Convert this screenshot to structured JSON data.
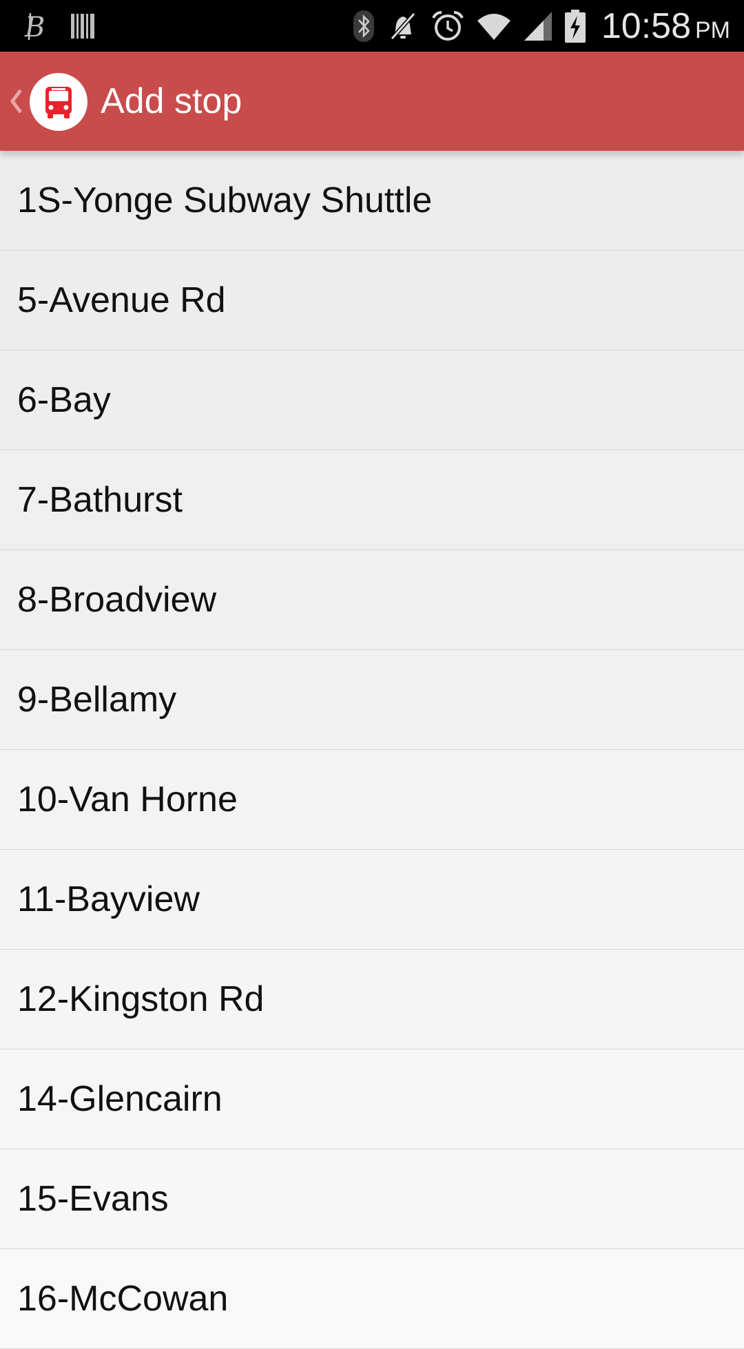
{
  "status_bar": {
    "time": "10:58",
    "ampm": "PM",
    "icons": [
      "b-notification-icon",
      "barcode-icon",
      "bluetooth-icon",
      "mute-icon",
      "alarm-icon",
      "wifi-icon",
      "signal-icon",
      "battery-charging-icon"
    ]
  },
  "action_bar": {
    "title": "Add stop",
    "background_color": "#c74c4b",
    "logo_icon": "bus-icon"
  },
  "routes": [
    {
      "label": "1S-Yonge Subway Shuttle"
    },
    {
      "label": "5-Avenue Rd"
    },
    {
      "label": "6-Bay"
    },
    {
      "label": "7-Bathurst"
    },
    {
      "label": "8-Broadview"
    },
    {
      "label": "9-Bellamy"
    },
    {
      "label": "10-Van Horne"
    },
    {
      "label": "11-Bayview"
    },
    {
      "label": "12-Kingston Rd"
    },
    {
      "label": "14-Glencairn"
    },
    {
      "label": "15-Evans"
    },
    {
      "label": "16-McCowan"
    }
  ]
}
